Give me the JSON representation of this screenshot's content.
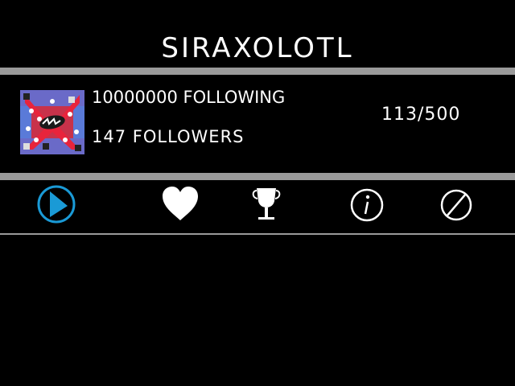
{
  "profile": {
    "username": "SIRAXOLOTL",
    "following": "10000000 FOLLOWING",
    "followers": "147 FOLLOWERS",
    "progress": "113/500"
  },
  "tabs": [
    {
      "icon": "play-icon",
      "active": true
    },
    {
      "icon": "heart-icon",
      "active": false
    },
    {
      "icon": "trophy-icon",
      "active": false
    },
    {
      "icon": "info-icon",
      "active": false
    },
    {
      "icon": "block-icon",
      "active": false
    }
  ],
  "colors": {
    "background": "#000000",
    "divider": "#9a9a9a",
    "active_tab": "#1a9ad6",
    "text": "#ffffff"
  }
}
